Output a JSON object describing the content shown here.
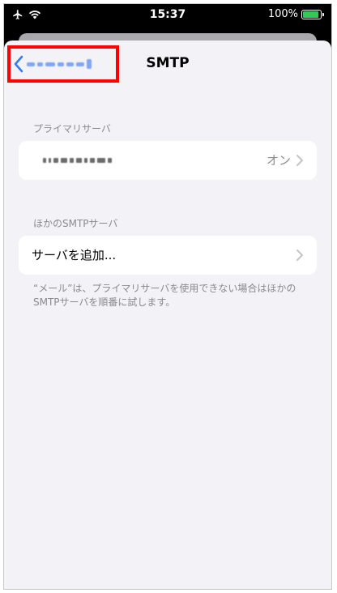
{
  "status_bar": {
    "time": "15:37",
    "battery_percent": "100%",
    "airplane_icon": "airplane-icon",
    "wifi_icon": "wifi-icon",
    "battery_icon": "battery-charging-icon"
  },
  "nav": {
    "title": "SMTP",
    "back_icon": "chevron-left-icon"
  },
  "primary_section": {
    "header": "プライマリサーバ",
    "status": "オン"
  },
  "other_section": {
    "header": "ほかのSMTPサーバ",
    "add_server_label": "サーバを追加..."
  },
  "footer": {
    "text": "“メール”は、プライマリサーバを使用できない場合はほかのSMTPサーバを順番に試します。"
  },
  "colors": {
    "accent": "#3478f6",
    "highlight_box": "#ff0000",
    "battery_fill": "#34c759",
    "background": "#f2f2f7"
  }
}
